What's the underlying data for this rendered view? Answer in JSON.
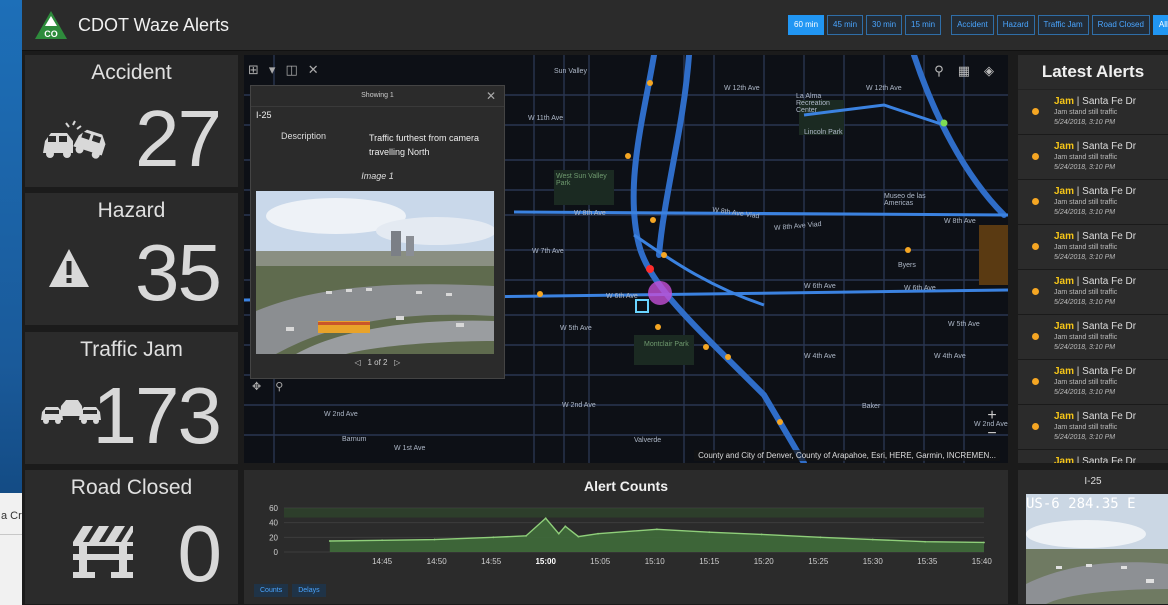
{
  "header": {
    "logo_text": "CO",
    "title": "CDOT Waze Alerts",
    "time_filters": [
      "60 min",
      "45 min",
      "30 min",
      "15 min"
    ],
    "type_filters": [
      "Accident",
      "Hazard",
      "Traffic Jam",
      "Road Closed",
      "All"
    ],
    "active_time": "60 min",
    "active_type": "All"
  },
  "stats": [
    {
      "title": "Accident",
      "value": "27",
      "icon": "car-crash-icon"
    },
    {
      "title": "Hazard",
      "value": "35",
      "icon": "warning-triangle-icon"
    },
    {
      "title": "Traffic Jam",
      "value": "173",
      "icon": "traffic-jam-icon"
    },
    {
      "title": "Road Closed",
      "value": "0",
      "icon": "road-barrier-icon"
    }
  ],
  "map": {
    "streets": [
      {
        "label": "Sun Valley"
      },
      {
        "label": "W 12th Ave"
      },
      {
        "label": "W 12th Ave"
      },
      {
        "label": "W 11th Ave"
      },
      {
        "label": "La Alma Recreation Center"
      },
      {
        "label": "Lincoln Park"
      },
      {
        "label": "W 8th Ave"
      },
      {
        "label": "W 8th Ave Viad"
      },
      {
        "label": "W 8th Ave Viad"
      },
      {
        "label": "W 8th Ave"
      },
      {
        "label": "W 7th Ave"
      },
      {
        "label": "W 6th Ave"
      },
      {
        "label": "W 6th Ave"
      },
      {
        "label": "W 6th Ave"
      },
      {
        "label": "W 5th Ave"
      },
      {
        "label": "W 5th Ave"
      },
      {
        "label": "W 4th Ave"
      },
      {
        "label": "W 4th Ave"
      },
      {
        "label": "W 2nd Ave"
      },
      {
        "label": "W 2nd Ave"
      },
      {
        "label": "W 2nd Ave"
      },
      {
        "label": "W 1st Ave"
      },
      {
        "label": "Barnum"
      },
      {
        "label": "Valverde"
      },
      {
        "label": "Baker"
      },
      {
        "label": "Byers"
      },
      {
        "label": "Museo de las Americas"
      },
      {
        "label": "West Sun Valley Park"
      },
      {
        "label": "Montclair Park"
      }
    ],
    "attribution": "County and City of Denver, County of Arapahoe, Esri, HERE, Garmin, INCREMEN...",
    "zoom_in": "+",
    "zoom_out": "−"
  },
  "popup": {
    "header": "Showing 1",
    "feature_title": "I-25",
    "description_label": "Description",
    "description_value": "Traffic furthest from camera travelling North",
    "image_caption": "Image 1",
    "pager": "1 of 2"
  },
  "alerts": {
    "title": "Latest Alerts",
    "items": [
      {
        "type": "Jam",
        "road": "Santa Fe Dr",
        "desc": "Jam stand still traffic",
        "time": "5/24/2018, 3:10 PM"
      },
      {
        "type": "Jam",
        "road": "Santa Fe Dr",
        "desc": "Jam stand still traffic",
        "time": "5/24/2018, 3:10 PM"
      },
      {
        "type": "Jam",
        "road": "Santa Fe Dr",
        "desc": "Jam stand still traffic",
        "time": "5/24/2018, 3:10 PM"
      },
      {
        "type": "Jam",
        "road": "Santa Fe Dr",
        "desc": "Jam stand still traffic",
        "time": "5/24/2018, 3:10 PM"
      },
      {
        "type": "Jam",
        "road": "Santa Fe Dr",
        "desc": "Jam stand still traffic",
        "time": "5/24/2018, 3:10 PM"
      },
      {
        "type": "Jam",
        "road": "Santa Fe Dr",
        "desc": "Jam stand still traffic",
        "time": "5/24/2018, 3:10 PM"
      },
      {
        "type": "Jam",
        "road": "Santa Fe Dr",
        "desc": "Jam stand still traffic",
        "time": "5/24/2018, 3:10 PM"
      },
      {
        "type": "Jam",
        "road": "Santa Fe Dr",
        "desc": "Jam stand still traffic",
        "time": "5/24/2018, 3:10 PM"
      },
      {
        "type": "Jam",
        "road": "Santa Fe Dr",
        "desc": "",
        "time": ""
      }
    ]
  },
  "chart": {
    "tabs": [
      "Counts",
      "Delays"
    ]
  },
  "chart_data": {
    "type": "line",
    "title": "Alert Counts",
    "x_ticks": [
      "14:45",
      "14:50",
      "14:55",
      "15:00",
      "15:05",
      "15:10",
      "15:15",
      "15:20",
      "15:25",
      "15:30",
      "15:35",
      "15:40"
    ],
    "y_ticks": [
      0,
      20,
      40,
      60
    ],
    "ylim": [
      0,
      60
    ],
    "series": [
      {
        "x": [
          14.67,
          14.75,
          14.83,
          14.92,
          14.97,
          15.0,
          15.02,
          15.03,
          15.05,
          15.08,
          15.17,
          15.25,
          15.33,
          15.42,
          15.5,
          15.58,
          15.67
        ],
        "values": [
          15,
          16,
          17,
          20,
          22,
          46,
          25,
          35,
          21,
          25,
          31,
          27,
          24,
          20,
          17,
          14,
          13
        ]
      }
    ],
    "colors": {
      "fill": "#3f6b3a",
      "line": "#8fcf7a"
    }
  },
  "camera": {
    "title": "I-25",
    "overlay": "US-6   284.35 E"
  },
  "desktop": {
    "peek_text": "a Cr"
  },
  "colors": {
    "accent": "#2196f3",
    "alert_dot": "#f5a623",
    "alert_type": "#f5c518"
  }
}
